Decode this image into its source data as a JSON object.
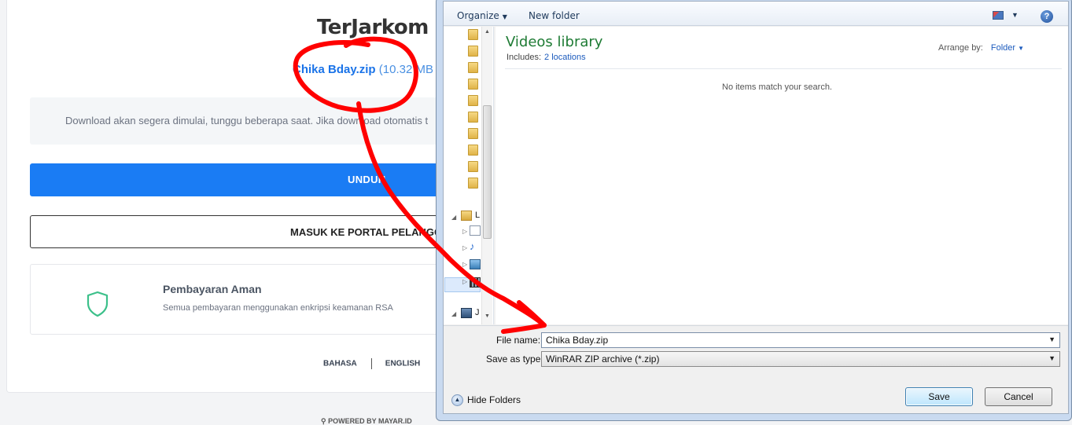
{
  "page": {
    "store_name": "TerJarkom",
    "file_name": "Chika Bday.zip",
    "file_size": "(10.32 MB",
    "notice": "Download akan segera dimulai, tunggu beberapa saat. Jika download otomatis t",
    "download_button": "UNDUH",
    "portal_button": "MASUK KE PORTAL PELANGGA",
    "secure_title": "Pembayaran Aman",
    "secure_desc": "Semua pembayaran menggunakan enkripsi keamanan RSA",
    "lang_label": "BAHASA",
    "lang_value": "ENGLISH",
    "powered_by": "POWERED BY MAYAR.ID",
    "accent_color": "#1a7cf4",
    "shield_color": "#3cc08a"
  },
  "dialog": {
    "toolbar": {
      "organize": "Organize",
      "new_folder": "New folder",
      "help": "?"
    },
    "nav": {
      "libraries_label": "L",
      "computer_label": "J"
    },
    "library": {
      "title": "Videos library",
      "includes_label": "Includes:",
      "locations_link": "2 locations",
      "arrange_label": "Arrange by:",
      "arrange_value": "Folder",
      "empty_message": "No items match your search."
    },
    "form": {
      "file_name_label": "File name:",
      "file_name_value": "Chika Bday.zip",
      "save_type_label": "Save as type:",
      "save_type_value": "WinRAR ZIP archive (*.zip)",
      "hide_folders": "Hide Folders",
      "save_button": "Save",
      "cancel_button": "Cancel"
    }
  },
  "annotation": {
    "color": "#ff0000"
  }
}
